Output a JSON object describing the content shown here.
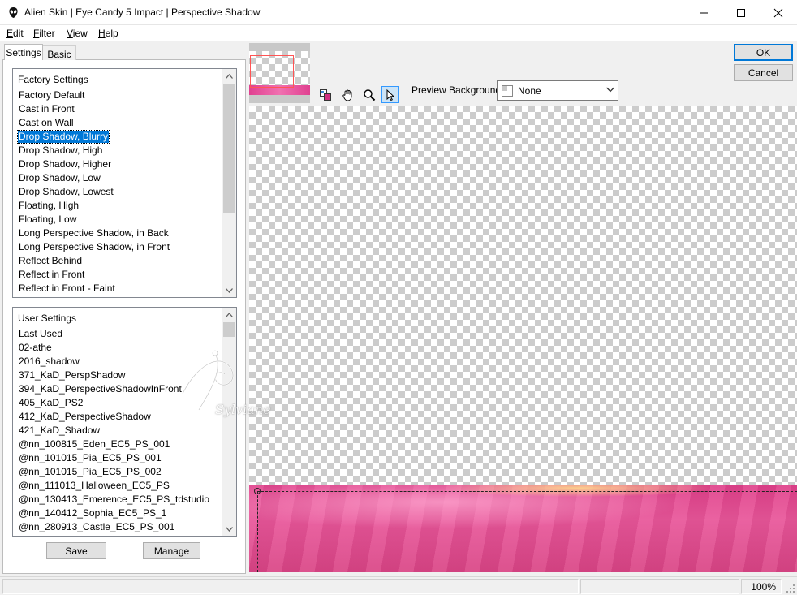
{
  "window": {
    "title": "Alien Skin | Eye Candy 5 Impact | Perspective Shadow",
    "controls": [
      "minimize-icon",
      "maximize-icon",
      "close-icon"
    ]
  },
  "menu": {
    "items": [
      {
        "accel": "E",
        "rest": "dit"
      },
      {
        "accel": "F",
        "rest": "ilter"
      },
      {
        "accel": "V",
        "rest": "iew"
      },
      {
        "accel": "H",
        "rest": "elp"
      }
    ]
  },
  "tabs": [
    {
      "label": "Settings",
      "active": true
    },
    {
      "label": "Basic",
      "active": false
    }
  ],
  "factory_settings": {
    "header": "Factory Settings",
    "selected_index": 3,
    "items": [
      "Factory Default",
      "Cast in Front",
      "Cast on Wall",
      "Drop Shadow, Blurry",
      "Drop Shadow, High",
      "Drop Shadow, Higher",
      "Drop Shadow, Low",
      "Drop Shadow, Lowest",
      "Floating, High",
      "Floating, Low",
      "Long Perspective Shadow, in Back",
      "Long Perspective Shadow, in Front",
      "Reflect Behind",
      "Reflect in Front",
      "Reflect in Front - Faint"
    ]
  },
  "user_settings": {
    "header": "User Settings",
    "items": [
      "Last Used",
      "02-athe",
      "2016_shadow",
      "371_KaD_PerspShadow",
      "394_KaD_PerspectiveShadowInFront",
      "405_KaD_PS2",
      "412_KaD_PerspectiveShadow",
      "421_KaD_Shadow",
      "@nn_100815_Eden_EC5_PS_001",
      "@nn_101015_Pia_EC5_PS_001",
      "@nn_101015_Pia_EC5_PS_002",
      "@nn_111013_Halloween_EC5_PS",
      "@nn_130413_Emerence_EC5_PS_tdstudio",
      "@nn_140412_Sophia_EC5_PS_1",
      "@nn_280913_Castle_EC5_PS_001"
    ]
  },
  "buttons": {
    "save": "Save",
    "manage": "Manage",
    "ok": "OK",
    "cancel": "Cancel"
  },
  "toolbar": {
    "tools": [
      "preview-swap-icon",
      "hand-icon",
      "zoom-icon",
      "arrow-pointer-icon"
    ],
    "active_tool": "arrow-pointer-icon"
  },
  "preview_background": {
    "label": "Preview Background:",
    "value": "None"
  },
  "watermark": {
    "text": "Sylviane"
  },
  "status": {
    "zoom": "100%"
  },
  "colors": {
    "selection": "#0078d7",
    "accent_pink": "#e04090",
    "default_button_border": "#0078d7"
  }
}
